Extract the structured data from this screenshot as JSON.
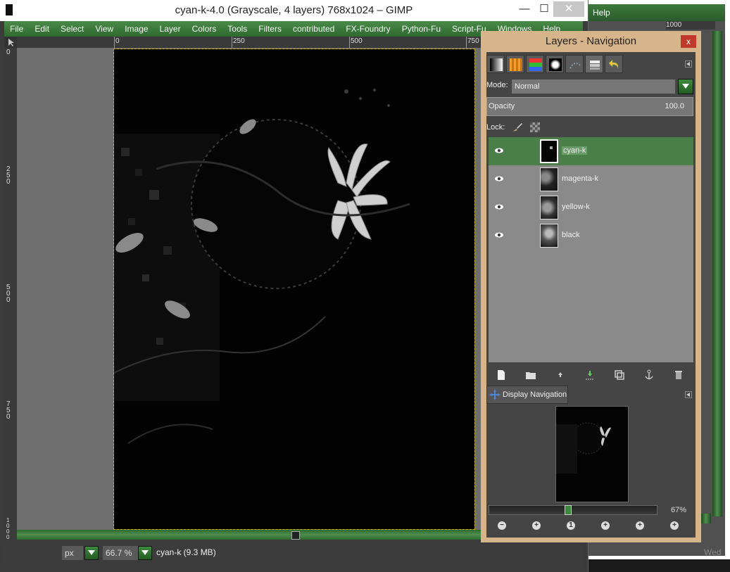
{
  "background_window": {
    "menu_label": "Help",
    "ruler_label": "1000",
    "clock_fragment": "Wed"
  },
  "window": {
    "title": "cyan-k-4.0 (Grayscale, 4 layers) 768x1024 – GIMP",
    "minimize_glyph": "—",
    "maximize_glyph": "☐",
    "close_glyph": "✕"
  },
  "menubar": {
    "items": [
      "File",
      "Edit",
      "Select",
      "View",
      "Image",
      "Layer",
      "Colors",
      "Tools",
      "Filters",
      "contributed",
      "FX-Foundry",
      "Python-Fu",
      "Script-Fu",
      "Windows",
      "Help"
    ]
  },
  "rulers": {
    "horizontal": [
      "0",
      "250",
      "500",
      "750"
    ],
    "vertical": [
      "0",
      "250",
      "500",
      "750",
      "1000"
    ]
  },
  "statusbar": {
    "unit": "px",
    "zoom": "66.7 %",
    "message": "cyan-k (9.3 MB)"
  },
  "layers_dock": {
    "title": "Layers - Navigation",
    "close_glyph": "x",
    "tab_icons": [
      "gradient-icon",
      "patterns-icon",
      "palettes-icon",
      "brushes-icon",
      "paths-icon",
      "layers-icon",
      "undo-icon"
    ],
    "mode_label": "Mode:",
    "mode_value": "Normal",
    "opacity_label": "Opacity",
    "opacity_value": "100.0",
    "lock_label": "Lock:",
    "layers": [
      {
        "name": "cyan-k",
        "selected": true
      },
      {
        "name": "magenta-k",
        "selected": false
      },
      {
        "name": "yellow-k",
        "selected": false
      },
      {
        "name": "black",
        "selected": false
      }
    ],
    "layer_button_icons": [
      "new-layer-icon",
      "new-layer-group-icon",
      "raise-layer-icon",
      "lower-layer-icon",
      "duplicate-layer-icon",
      "anchor-layer-icon",
      "delete-layer-icon"
    ],
    "navigation_tab_label": "Display Navigation",
    "zoom_fraction": 0.47,
    "zoom_value": "67%",
    "nav_button_glyphs": [
      "−",
      "+",
      "1",
      "+",
      "+",
      "+"
    ]
  },
  "colors": {
    "menubar_green": "#3f7f3f",
    "selected_layer": "#4a7f4a",
    "dock_frame": "#d7b58a",
    "canvas_background": "#6e6e6e"
  }
}
